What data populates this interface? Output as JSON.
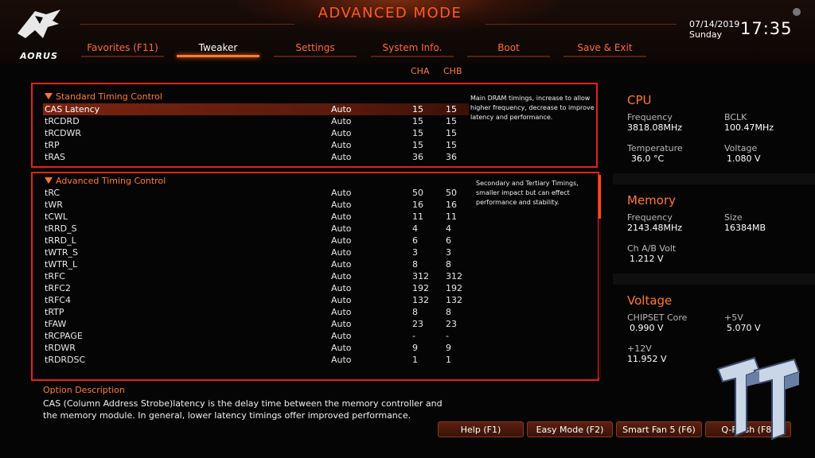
{
  "header": {
    "title": "ADVANCED MODE",
    "logo_text": "AORUS",
    "date": "07/14/2019",
    "weekday": "Sunday",
    "time": "17:35"
  },
  "tabs": [
    {
      "label": "Favorites (F11)"
    },
    {
      "label": "Tweaker"
    },
    {
      "label": "Settings"
    },
    {
      "label": "System Info."
    },
    {
      "label": "Boot"
    },
    {
      "label": "Save & Exit"
    }
  ],
  "columns": {
    "cha": "CHA",
    "chb": "CHB"
  },
  "standard": {
    "title": "Standard Timing Control",
    "description": "Main DRAM timings, increase to allow higher frequency, decrease to improve latency and performance.",
    "rows": [
      {
        "label": "CAS Latency",
        "mode": "Auto",
        "cha": "15",
        "chb": "15"
      },
      {
        "label": "tRCDRD",
        "mode": "Auto",
        "cha": "15",
        "chb": "15"
      },
      {
        "label": "tRCDWR",
        "mode": "Auto",
        "cha": "15",
        "chb": "15"
      },
      {
        "label": "tRP",
        "mode": "Auto",
        "cha": "15",
        "chb": "15"
      },
      {
        "label": "tRAS",
        "mode": "Auto",
        "cha": "36",
        "chb": "36"
      }
    ]
  },
  "advanced": {
    "title": "Advanced Timing Control",
    "description": "Secondary and Tertiary Timings, smaller impact but can effect performance and stability.",
    "rows": [
      {
        "label": "tRC",
        "mode": "Auto",
        "cha": "50",
        "chb": "50"
      },
      {
        "label": "tWR",
        "mode": "Auto",
        "cha": "16",
        "chb": "16"
      },
      {
        "label": "tCWL",
        "mode": "Auto",
        "cha": "11",
        "chb": "11"
      },
      {
        "label": "tRRD_S",
        "mode": "Auto",
        "cha": "4",
        "chb": "4"
      },
      {
        "label": "tRRD_L",
        "mode": "Auto",
        "cha": "6",
        "chb": "6"
      },
      {
        "label": "tWTR_S",
        "mode": "Auto",
        "cha": "3",
        "chb": "3"
      },
      {
        "label": "tWTR_L",
        "mode": "Auto",
        "cha": "8",
        "chb": "8"
      },
      {
        "label": "tRFC",
        "mode": "Auto",
        "cha": "312",
        "chb": "312"
      },
      {
        "label": "tRFC2",
        "mode": "Auto",
        "cha": "192",
        "chb": "192"
      },
      {
        "label": "tRFC4",
        "mode": "Auto",
        "cha": "132",
        "chb": "132"
      },
      {
        "label": "tRTP",
        "mode": "Auto",
        "cha": "8",
        "chb": "8"
      },
      {
        "label": "tFAW",
        "mode": "Auto",
        "cha": "23",
        "chb": "23"
      },
      {
        "label": "tRCPAGE",
        "mode": "Auto",
        "cha": "-",
        "chb": "-"
      },
      {
        "label": "tRDWR",
        "mode": "Auto",
        "cha": "9",
        "chb": "9"
      },
      {
        "label": "tRDRDSC",
        "mode": "Auto",
        "cha": "1",
        "chb": "1"
      }
    ]
  },
  "option_description": {
    "title": "Option Description",
    "text": "CAS (Column Address Strobe)latency is the delay time between the memory controller and the memory module. In general, lower latency timings offer improved performance."
  },
  "sidebar": {
    "cpu": {
      "title": "CPU",
      "frequency_label": "Frequency",
      "frequency": "3818.08MHz",
      "bclk_label": "BCLK",
      "bclk": "100.47MHz",
      "temperature_label": "Temperature",
      "temperature": "36.0 °C",
      "voltage_label": "Voltage",
      "voltage": "1.080 V"
    },
    "memory": {
      "title": "Memory",
      "frequency_label": "Frequency",
      "frequency": "2143.48MHz",
      "size_label": "Size",
      "size": "16384MB",
      "volt_label": "Ch A/B Volt",
      "volt": "1.212 V"
    },
    "voltage": {
      "title": "Voltage",
      "chipset_label": "CHIPSET Core",
      "chipset": "0.990 V",
      "p5v_label": "+5V",
      "p5v": "5.070 V",
      "p12v_label": "+12V",
      "p12v": "11.952 V"
    }
  },
  "buttons": [
    {
      "label": "Help (F1)"
    },
    {
      "label": "Easy Mode (F2)"
    },
    {
      "label": "Smart Fan 5 (F6)"
    },
    {
      "label": "Q-Flash (F8)"
    }
  ],
  "colors": {
    "accent": "#ff7a3a",
    "border": "#e0231c",
    "selected": "#7a2410"
  }
}
